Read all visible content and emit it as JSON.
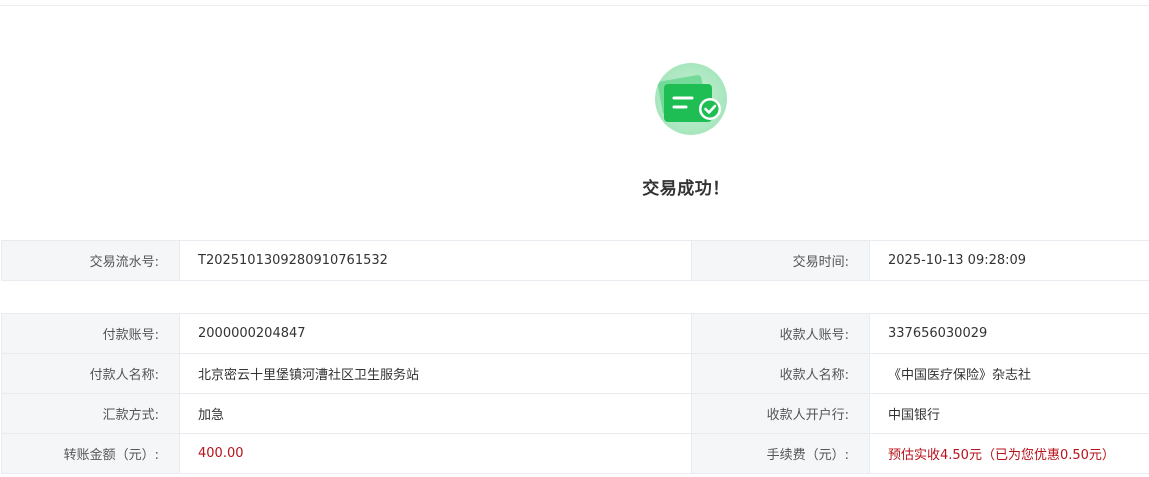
{
  "status": {
    "title": "交易成功！"
  },
  "transaction": {
    "serial_label": "交易流水号:",
    "serial_value": "T2025101309280910761532",
    "time_label": "交易时间:",
    "time_value": "2025-10-13 09:28:09"
  },
  "details": {
    "payer_account_label": "付款账号:",
    "payer_account_value": "2000000204847",
    "payee_account_label": "收款人账号:",
    "payee_account_value": "337656030029",
    "payer_name_label": "付款人名称:",
    "payer_name_value": "北京密云十里堡镇河漕社区卫生服务站",
    "payee_name_label": "收款人名称:",
    "payee_name_value": "《中国医疗保险》杂志社",
    "remit_method_label": "汇款方式:",
    "remit_method_value": "加急",
    "payee_bank_label": "收款人开户行:",
    "payee_bank_value": "中国银行",
    "amount_label": "转账金额（元）:",
    "amount_value": "400.00",
    "fee_label": "手续费（元）:",
    "fee_estimate": "预估实收4.50元",
    "fee_discount": "（已为您优惠0.50元）"
  },
  "colors": {
    "success_green": "#22c25b",
    "amount_red": "#b8121b",
    "label_bg": "#f5f6f8",
    "border": "#e8ebf0"
  },
  "icons": {
    "status_icon": "payment-success-icon"
  }
}
